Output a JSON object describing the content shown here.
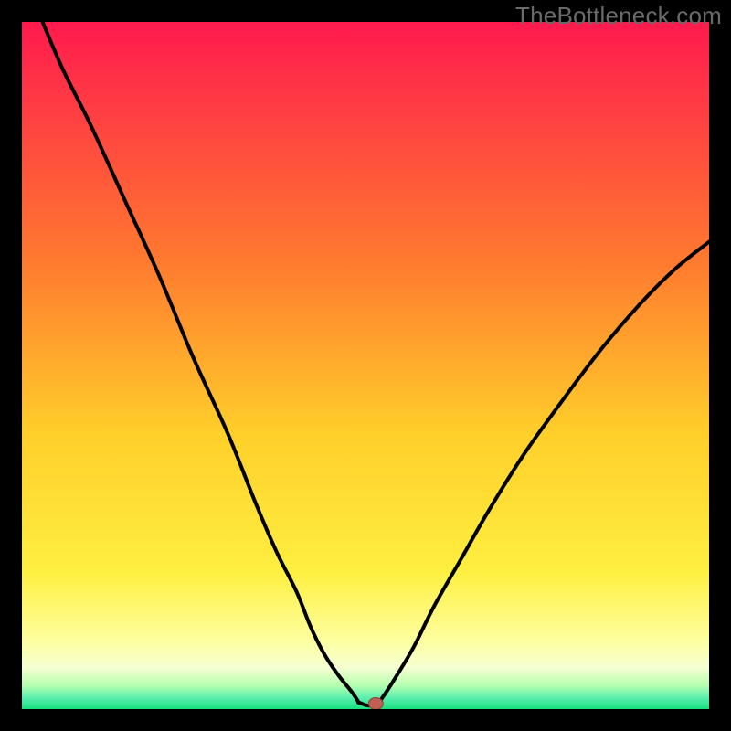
{
  "watermark": "TheBottleneck.com",
  "colors": {
    "top_red": "#ff1a4e",
    "mid_orange": "#ff9a27",
    "mid_yellow": "#ffe733",
    "pale_yellow": "#feff9f",
    "cream": "#f5ffd2",
    "pale_green": "#b8ffb0",
    "green": "#18e07d",
    "curve": "#000000",
    "marker": "#c06054",
    "frame": "#000000"
  },
  "chart_data": {
    "type": "line",
    "title": "",
    "xlabel": "",
    "ylabel": "",
    "xlim": [
      0,
      100
    ],
    "ylim": [
      0,
      100
    ],
    "series": [
      {
        "name": "left-branch",
        "x": [
          3,
          6,
          10,
          15,
          20,
          25,
          30,
          34,
          37,
          40,
          42,
          44,
          46,
          48,
          49
        ],
        "y": [
          100,
          93,
          85,
          74,
          63,
          51,
          40,
          30,
          23,
          17,
          12,
          8,
          5,
          2.5,
          1
        ]
      },
      {
        "name": "valley-floor",
        "x": [
          49,
          50.5,
          52
        ],
        "y": [
          1,
          0.5,
          1
        ]
      },
      {
        "name": "right-branch",
        "x": [
          52,
          54,
          57,
          60,
          64,
          68,
          73,
          78,
          84,
          90,
          95,
          100
        ],
        "y": [
          1,
          4,
          9,
          15,
          22,
          29,
          37,
          44,
          52,
          59,
          64,
          68
        ]
      }
    ],
    "marker": {
      "x": 51.5,
      "y": 0.8,
      "label": ""
    },
    "gradient_bands_approx": [
      {
        "y_from": 100,
        "y_to": 50,
        "color": "red-to-orange"
      },
      {
        "y_from": 50,
        "y_to": 20,
        "color": "orange-to-yellow"
      },
      {
        "y_from": 20,
        "y_to": 7,
        "color": "yellow-to-pale"
      },
      {
        "y_from": 7,
        "y_to": 4,
        "color": "pale-yellow-band"
      },
      {
        "y_from": 4,
        "y_to": 2,
        "color": "pale-green-band"
      },
      {
        "y_from": 2,
        "y_to": 0,
        "color": "green"
      }
    ]
  }
}
